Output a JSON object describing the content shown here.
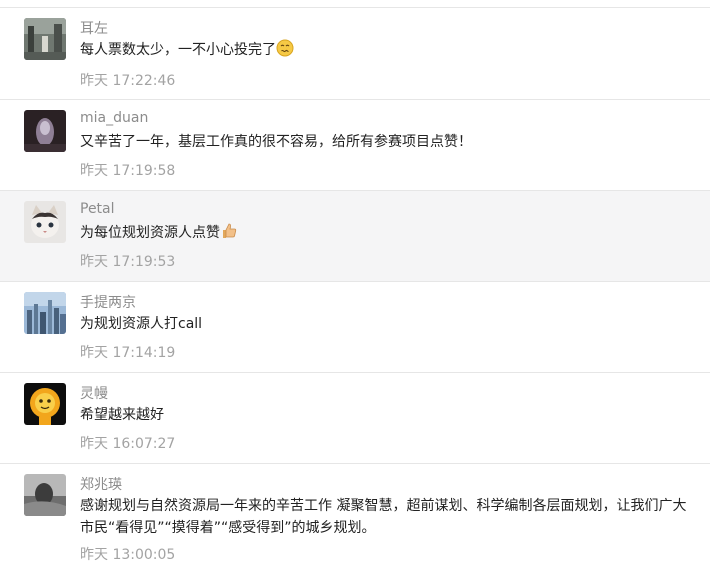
{
  "comments": [
    {
      "nick": "耳左",
      "text": "每人票数太少，一不小心投完了",
      "emoji": "awkward-face-emoji",
      "time": "昨天 17:22:46",
      "avatar": "avatar-street-photo"
    },
    {
      "nick": "mia_duan",
      "text": "又辛苦了一年，基层工作真的很不容易，给所有参赛项目点赞！",
      "time": "昨天 17:19:58",
      "avatar": "avatar-dark-portrait"
    },
    {
      "nick": "Petal",
      "text": "为每位规划资源人点赞",
      "emoji": "thumbs-up-emoji",
      "time": "昨天 17:19:53",
      "avatar": "avatar-cat"
    },
    {
      "nick": "手提两京",
      "text": "为规划资源人打call",
      "time": "昨天 17:14:19",
      "avatar": "avatar-city-skyline"
    },
    {
      "nick": "灵幔",
      "text": "希望越来越好",
      "time": "昨天 16:07:27",
      "avatar": "avatar-cartoon-lion"
    },
    {
      "nick": "郑兆瑛",
      "text": "感谢规划与自然资源局一年来的辛苦工作 凝聚智慧，超前谋划、科学编制各层面规划，让我们广大市民“看得见”“摸得着”“感受得到”的城乡规划。",
      "time": "昨天 13:00:05",
      "avatar": "avatar-gray-photo"
    }
  ],
  "colors": {
    "nick": "#8c8c8c",
    "text": "#222222",
    "time": "#a3a3a3",
    "divider": "#e6e6e6",
    "highlight_bg": "#f5f5f6"
  }
}
